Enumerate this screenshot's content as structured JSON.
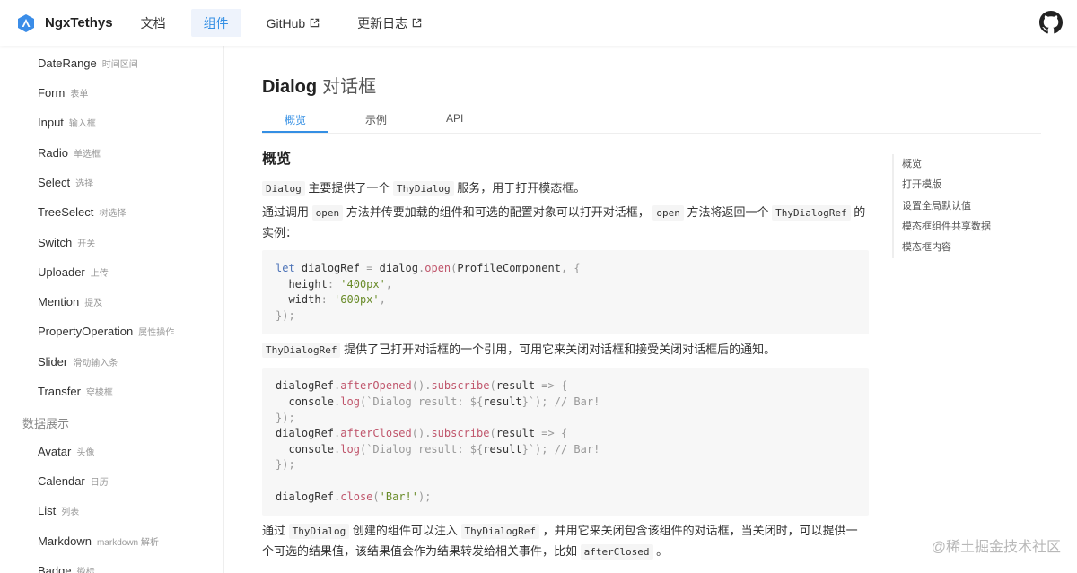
{
  "header": {
    "logo_text": "NgxTethys",
    "nav": [
      {
        "label": "文档",
        "external": false
      },
      {
        "label": "组件",
        "external": false,
        "active": true
      },
      {
        "label": "GitHub",
        "external": true
      },
      {
        "label": "更新日志",
        "external": true
      }
    ]
  },
  "sidebar": {
    "items": [
      {
        "label": "DateRange",
        "sub": "时间区间"
      },
      {
        "label": "Form",
        "sub": "表单"
      },
      {
        "label": "Input",
        "sub": "输入框"
      },
      {
        "label": "Radio",
        "sub": "单选框"
      },
      {
        "label": "Select",
        "sub": "选择"
      },
      {
        "label": "TreeSelect",
        "sub": "树选择"
      },
      {
        "label": "Switch",
        "sub": "开关"
      },
      {
        "label": "Uploader",
        "sub": "上传"
      },
      {
        "label": "Mention",
        "sub": "提及"
      },
      {
        "label": "PropertyOperation",
        "sub": "属性操作"
      },
      {
        "label": "Slider",
        "sub": "滑动输入条"
      },
      {
        "label": "Transfer",
        "sub": "穿梭框"
      }
    ],
    "group": "数据展示",
    "group_items": [
      {
        "label": "Avatar",
        "sub": "头像"
      },
      {
        "label": "Calendar",
        "sub": "日历"
      },
      {
        "label": "List",
        "sub": "列表"
      },
      {
        "label": "Markdown",
        "sub": "markdown 解析"
      },
      {
        "label": "Badge",
        "sub": "徽标"
      }
    ]
  },
  "page": {
    "title_en": "Dialog",
    "title_zh": "对话框",
    "tabs": [
      "概览",
      "示例",
      "API"
    ]
  },
  "content": {
    "heading": "概览",
    "p1": {
      "code1": "Dialog",
      "text1": "主要提供了一个",
      "code2": "ThyDialog",
      "text2": "服务，用于打开模态框。"
    },
    "p2": {
      "text1": "通过调用",
      "code1": "open",
      "text2": "方法并传要加载的组件和可选的配置对象可以打开对话框，",
      "code2": "open",
      "text3": "方法将返回一个",
      "code3": "ThyDialogRef",
      "text4": "的实例："
    },
    "code1": {
      "let": "let",
      "var": "dialogRef",
      "eq": "=",
      "obj": "dialog",
      "method": "open",
      "arg": "ProfileComponent",
      "height_key": "height",
      "height_val": "'400px'",
      "width_key": "width",
      "width_val": "'600px'"
    },
    "p3": {
      "code1": "ThyDialogRef",
      "text1": "提供了已打开对话框的一个引用，可用它来关闭对话框和接受关闭对话框后的通知。"
    },
    "code2": {
      "var": "dialogRef",
      "after_opened": "afterOpened",
      "subscribe": "subscribe",
      "result": "result",
      "console": "console",
      "log": "log",
      "template_text": "`Dialog result: ${",
      "template_end": "}`",
      "comment": "// Bar!",
      "after_closed": "afterClosed",
      "close": "close",
      "close_arg": "'Bar!'"
    },
    "p4": {
      "text1": "通过",
      "code1": "ThyDialog",
      "text2": "创建的组件可以注入",
      "code2": "ThyDialogRef",
      "text3": "，并用它来关闭包含该组件的对话框，当关闭时，可以提供一个可选的结果值，该结果值会作为结果转发给相关事件，比如",
      "code3": "afterClosed",
      "text4": "。"
    }
  },
  "toc": [
    "概览",
    "打开模版",
    "设置全局默认值",
    "模态框组件共享数据",
    "模态框内容"
  ],
  "watermark": "@稀土掘金技术社区",
  "colors": {
    "accent": "#348fe4",
    "nav_active_bg": "#eef3fc"
  }
}
